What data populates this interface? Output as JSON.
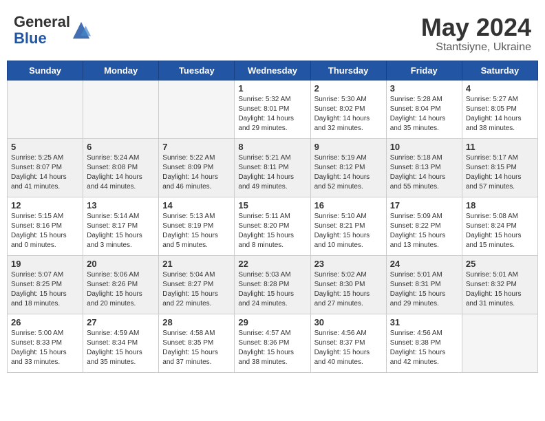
{
  "logo": {
    "general": "General",
    "blue": "Blue"
  },
  "header": {
    "title": "May 2024",
    "subtitle": "Stantsiyne, Ukraine"
  },
  "weekdays": [
    "Sunday",
    "Monday",
    "Tuesday",
    "Wednesday",
    "Thursday",
    "Friday",
    "Saturday"
  ],
  "weeks": [
    {
      "shaded": false,
      "days": [
        {
          "number": "",
          "info": "",
          "empty": true
        },
        {
          "number": "",
          "info": "",
          "empty": true
        },
        {
          "number": "",
          "info": "",
          "empty": true
        },
        {
          "number": "1",
          "info": "Sunrise: 5:32 AM\nSunset: 8:01 PM\nDaylight: 14 hours\nand 29 minutes.",
          "empty": false
        },
        {
          "number": "2",
          "info": "Sunrise: 5:30 AM\nSunset: 8:02 PM\nDaylight: 14 hours\nand 32 minutes.",
          "empty": false
        },
        {
          "number": "3",
          "info": "Sunrise: 5:28 AM\nSunset: 8:04 PM\nDaylight: 14 hours\nand 35 minutes.",
          "empty": false
        },
        {
          "number": "4",
          "info": "Sunrise: 5:27 AM\nSunset: 8:05 PM\nDaylight: 14 hours\nand 38 minutes.",
          "empty": false
        }
      ]
    },
    {
      "shaded": true,
      "days": [
        {
          "number": "5",
          "info": "Sunrise: 5:25 AM\nSunset: 8:07 PM\nDaylight: 14 hours\nand 41 minutes.",
          "empty": false
        },
        {
          "number": "6",
          "info": "Sunrise: 5:24 AM\nSunset: 8:08 PM\nDaylight: 14 hours\nand 44 minutes.",
          "empty": false
        },
        {
          "number": "7",
          "info": "Sunrise: 5:22 AM\nSunset: 8:09 PM\nDaylight: 14 hours\nand 46 minutes.",
          "empty": false
        },
        {
          "number": "8",
          "info": "Sunrise: 5:21 AM\nSunset: 8:11 PM\nDaylight: 14 hours\nand 49 minutes.",
          "empty": false
        },
        {
          "number": "9",
          "info": "Sunrise: 5:19 AM\nSunset: 8:12 PM\nDaylight: 14 hours\nand 52 minutes.",
          "empty": false
        },
        {
          "number": "10",
          "info": "Sunrise: 5:18 AM\nSunset: 8:13 PM\nDaylight: 14 hours\nand 55 minutes.",
          "empty": false
        },
        {
          "number": "11",
          "info": "Sunrise: 5:17 AM\nSunset: 8:15 PM\nDaylight: 14 hours\nand 57 minutes.",
          "empty": false
        }
      ]
    },
    {
      "shaded": false,
      "days": [
        {
          "number": "12",
          "info": "Sunrise: 5:15 AM\nSunset: 8:16 PM\nDaylight: 15 hours\nand 0 minutes.",
          "empty": false
        },
        {
          "number": "13",
          "info": "Sunrise: 5:14 AM\nSunset: 8:17 PM\nDaylight: 15 hours\nand 3 minutes.",
          "empty": false
        },
        {
          "number": "14",
          "info": "Sunrise: 5:13 AM\nSunset: 8:19 PM\nDaylight: 15 hours\nand 5 minutes.",
          "empty": false
        },
        {
          "number": "15",
          "info": "Sunrise: 5:11 AM\nSunset: 8:20 PM\nDaylight: 15 hours\nand 8 minutes.",
          "empty": false
        },
        {
          "number": "16",
          "info": "Sunrise: 5:10 AM\nSunset: 8:21 PM\nDaylight: 15 hours\nand 10 minutes.",
          "empty": false
        },
        {
          "number": "17",
          "info": "Sunrise: 5:09 AM\nSunset: 8:22 PM\nDaylight: 15 hours\nand 13 minutes.",
          "empty": false
        },
        {
          "number": "18",
          "info": "Sunrise: 5:08 AM\nSunset: 8:24 PM\nDaylight: 15 hours\nand 15 minutes.",
          "empty": false
        }
      ]
    },
    {
      "shaded": true,
      "days": [
        {
          "number": "19",
          "info": "Sunrise: 5:07 AM\nSunset: 8:25 PM\nDaylight: 15 hours\nand 18 minutes.",
          "empty": false
        },
        {
          "number": "20",
          "info": "Sunrise: 5:06 AM\nSunset: 8:26 PM\nDaylight: 15 hours\nand 20 minutes.",
          "empty": false
        },
        {
          "number": "21",
          "info": "Sunrise: 5:04 AM\nSunset: 8:27 PM\nDaylight: 15 hours\nand 22 minutes.",
          "empty": false
        },
        {
          "number": "22",
          "info": "Sunrise: 5:03 AM\nSunset: 8:28 PM\nDaylight: 15 hours\nand 24 minutes.",
          "empty": false
        },
        {
          "number": "23",
          "info": "Sunrise: 5:02 AM\nSunset: 8:30 PM\nDaylight: 15 hours\nand 27 minutes.",
          "empty": false
        },
        {
          "number": "24",
          "info": "Sunrise: 5:01 AM\nSunset: 8:31 PM\nDaylight: 15 hours\nand 29 minutes.",
          "empty": false
        },
        {
          "number": "25",
          "info": "Sunrise: 5:01 AM\nSunset: 8:32 PM\nDaylight: 15 hours\nand 31 minutes.",
          "empty": false
        }
      ]
    },
    {
      "shaded": false,
      "days": [
        {
          "number": "26",
          "info": "Sunrise: 5:00 AM\nSunset: 8:33 PM\nDaylight: 15 hours\nand 33 minutes.",
          "empty": false
        },
        {
          "number": "27",
          "info": "Sunrise: 4:59 AM\nSunset: 8:34 PM\nDaylight: 15 hours\nand 35 minutes.",
          "empty": false
        },
        {
          "number": "28",
          "info": "Sunrise: 4:58 AM\nSunset: 8:35 PM\nDaylight: 15 hours\nand 37 minutes.",
          "empty": false
        },
        {
          "number": "29",
          "info": "Sunrise: 4:57 AM\nSunset: 8:36 PM\nDaylight: 15 hours\nand 38 minutes.",
          "empty": false
        },
        {
          "number": "30",
          "info": "Sunrise: 4:56 AM\nSunset: 8:37 PM\nDaylight: 15 hours\nand 40 minutes.",
          "empty": false
        },
        {
          "number": "31",
          "info": "Sunrise: 4:56 AM\nSunset: 8:38 PM\nDaylight: 15 hours\nand 42 minutes.",
          "empty": false
        },
        {
          "number": "",
          "info": "",
          "empty": true
        }
      ]
    }
  ]
}
